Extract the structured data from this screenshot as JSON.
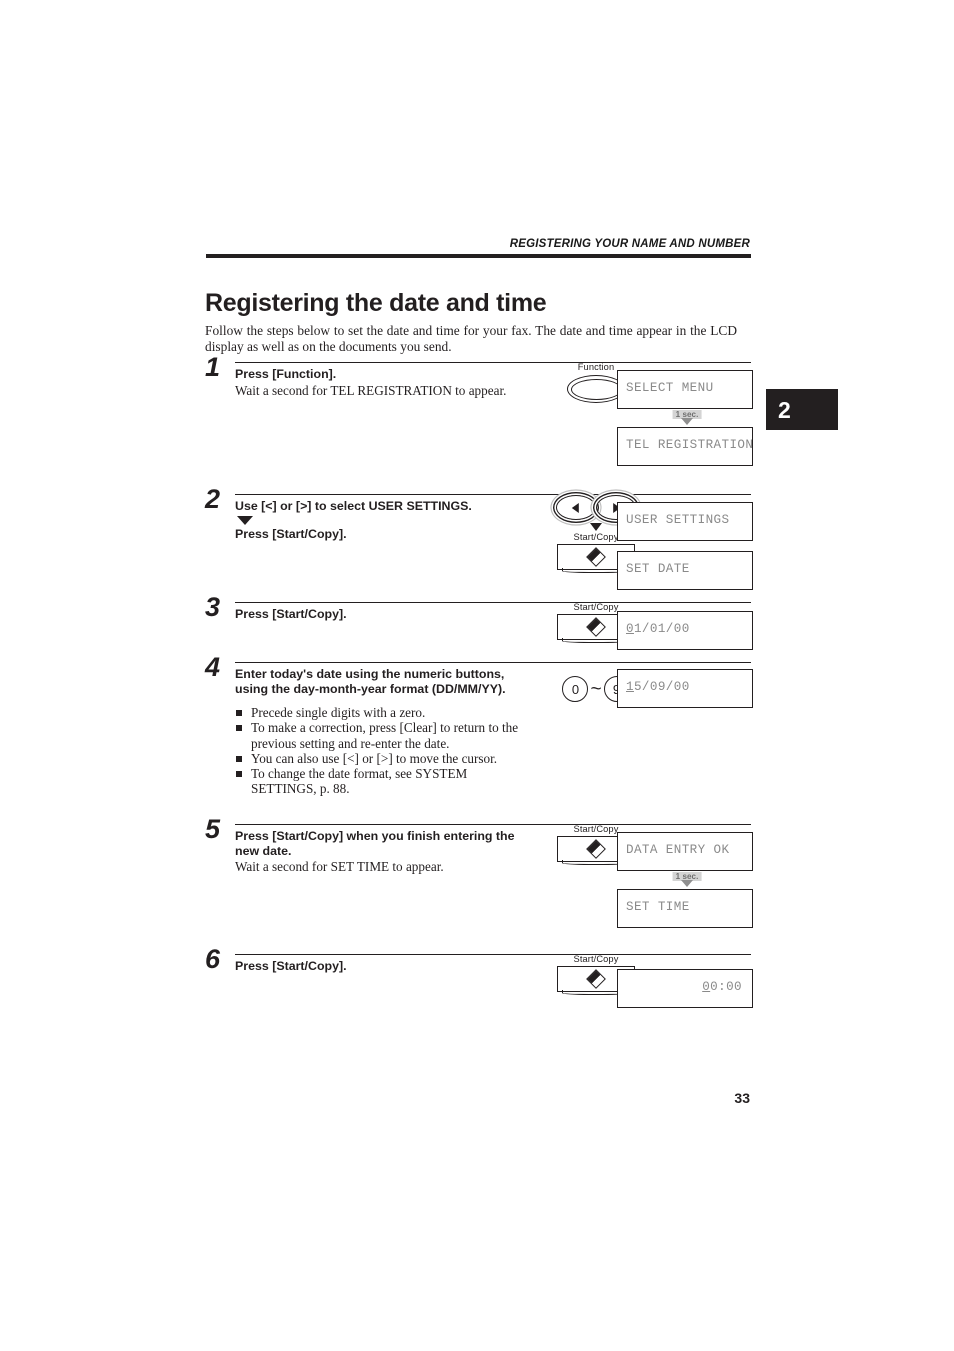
{
  "running_head": "REGISTERING YOUR NAME AND NUMBER",
  "title": "Registering the date and time",
  "intro": "Follow the steps below to set the date and time for your fax. The date and time appear in the LCD display as well as on the documents you send.",
  "chapter_tab": "2",
  "page_number": "33",
  "delay_label": "1 sec.",
  "buttons": {
    "function_label": "Function",
    "start_copy_label": "Start/Copy",
    "numeric_low": "0",
    "numeric_high": "9",
    "numeric_sep": "~"
  },
  "steps": [
    {
      "number": "1",
      "lead": "Press [Function].",
      "sub": "Wait a second for TEL REGISTRATION to appear.",
      "hw_label": "Function",
      "lcds": [
        {
          "cursor": "",
          "text": "SELECT MENU"
        },
        {
          "cursor": "",
          "text": "TEL REGISTRATION"
        }
      ]
    },
    {
      "number": "2",
      "lead": "Use [<] or [>] to select USER SETTINGS.",
      "lead2": "Press [Start/Copy].",
      "hw_label": "Start/Copy",
      "lcds": [
        {
          "cursor": "",
          "text": "USER SETTINGS"
        },
        {
          "cursor": "",
          "text": "SET DATE"
        }
      ]
    },
    {
      "number": "3",
      "lead": "Press [Start/Copy].",
      "hw_label": "Start/Copy",
      "lcds": [
        {
          "cursor": "0",
          "text": "1/01/00"
        }
      ]
    },
    {
      "number": "4",
      "lead": "Enter today's date using the numeric buttons, using the day-month-year format (DD/MM/YY).",
      "bullets": [
        "Precede single digits with a zero.",
        "To make a correction, press [Clear] to return to the previous setting and re-enter the date.",
        "You can also use [<] or [>] to move the cursor.",
        "To change the date format, see SYSTEM SETTINGS, p. 88."
      ],
      "lcds": [
        {
          "cursor": "1",
          "text": "5/09/00"
        }
      ]
    },
    {
      "number": "5",
      "lead": "Press [Start/Copy] when you finish entering the new date.",
      "sub": "Wait a second for SET TIME to appear.",
      "hw_label": "Start/Copy",
      "lcds": [
        {
          "cursor": "",
          "text": "DATA ENTRY OK"
        },
        {
          "cursor": "",
          "text": "SET TIME"
        }
      ]
    },
    {
      "number": "6",
      "lead": "Press [Start/Copy].",
      "hw_label": "Start/Copy",
      "lcds": [
        {
          "cursor": "0",
          "text": "0:00"
        }
      ]
    }
  ]
}
